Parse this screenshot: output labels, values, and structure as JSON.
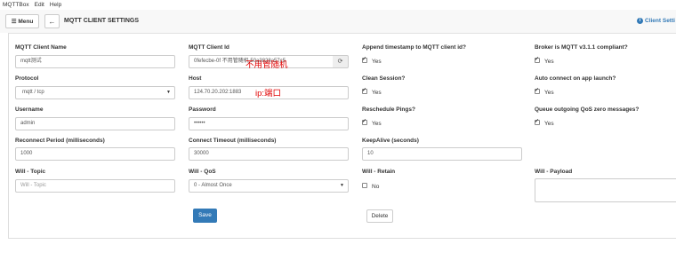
{
  "menubar": {
    "items": [
      "MQTTBox",
      "Edit",
      "Help"
    ]
  },
  "toolbar": {
    "menu_label": "☰ Menu",
    "back_icon": "←",
    "title": "MQTT CLIENT SETTINGS",
    "right_link": "Client Setti"
  },
  "form": {
    "client_name": {
      "label": "MQTT Client Name",
      "value": "mqtt测试"
    },
    "client_id": {
      "label": "MQTT Client Id",
      "value": "0fefecbe-0f  不用管随机 50a3828a57c5"
    },
    "append_ts": {
      "label": "Append timestamp to MQTT client id?",
      "option": "Yes"
    },
    "broker_compliant": {
      "label": "Broker is MQTT v3.1.1 compliant?",
      "option": "Yes"
    },
    "protocol": {
      "label": "Protocol",
      "value": "mqtt / tcp"
    },
    "host": {
      "label": "Host",
      "value": "124.70.20.202:1883"
    },
    "clean_session": {
      "label": "Clean Session?",
      "option": "Yes"
    },
    "auto_connect": {
      "label": "Auto connect on app launch?",
      "option": "Yes"
    },
    "username": {
      "label": "Username",
      "value": "admin"
    },
    "password": {
      "label": "Password",
      "value": "••••••"
    },
    "reschedule_pings": {
      "label": "Reschedule Pings?",
      "option": "Yes"
    },
    "queue_qos": {
      "label": "Queue outgoing QoS zero messages?",
      "option": "Yes"
    },
    "reconnect_period": {
      "label": "Reconnect Period (milliseconds)",
      "value": "1000"
    },
    "connect_timeout": {
      "label": "Connect Timeout (milliseconds)",
      "value": "30000"
    },
    "keepalive": {
      "label": "KeepAlive (seconds)",
      "value": "10"
    },
    "will_topic": {
      "label": "Will - Topic",
      "placeholder": "Will - Topic"
    },
    "will_qos": {
      "label": "Will - QoS",
      "value": "0 - Almost Once"
    },
    "will_retain": {
      "label": "Will - Retain",
      "option": "No"
    },
    "will_payload": {
      "label": "Will - Payload"
    }
  },
  "actions": {
    "save": "Save",
    "delete": "Delete"
  },
  "annotations": {
    "client_id_note": "不用管随机",
    "host_note": "ip:端口"
  },
  "colors": {
    "primary": "#337ab7",
    "annotation": "#e00000"
  }
}
